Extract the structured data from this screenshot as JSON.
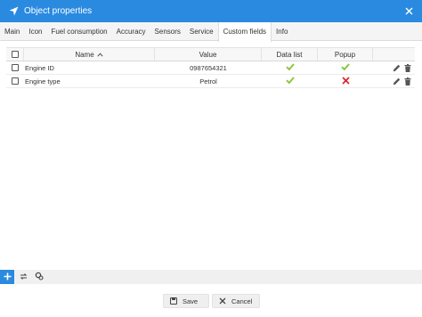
{
  "window": {
    "title": "Object properties",
    "accent_color": "#2a8ae0",
    "nav_icon": "navigation-arrow-icon",
    "close_icon": "close-icon"
  },
  "tabs": [
    {
      "label": "Main",
      "active": false
    },
    {
      "label": "Icon",
      "active": false
    },
    {
      "label": "Fuel consumption",
      "active": false
    },
    {
      "label": "Accuracy",
      "active": false
    },
    {
      "label": "Sensors",
      "active": false
    },
    {
      "label": "Service",
      "active": false
    },
    {
      "label": "Custom fields",
      "active": true
    },
    {
      "label": "Info",
      "active": false
    }
  ],
  "grid": {
    "columns": {
      "name": "Name",
      "value": "Value",
      "data_list": "Data list",
      "popup": "Popup"
    },
    "sort": {
      "column": "name",
      "direction": "ascending"
    },
    "rows": [
      {
        "name": "Engine ID",
        "value": "0987654321",
        "data_list": true,
        "popup": true
      },
      {
        "name": "Engine type",
        "value": "Petrol",
        "data_list": true,
        "popup": false
      }
    ],
    "check_color": "#8cc63f",
    "cross_color": "#d9272e"
  },
  "bottom_toolbar": {
    "add_icon": "plus-icon",
    "refresh_icon": "refresh-icon",
    "settings_icon": "settings-icon"
  },
  "footer": {
    "save_label": "Save",
    "cancel_label": "Cancel"
  }
}
